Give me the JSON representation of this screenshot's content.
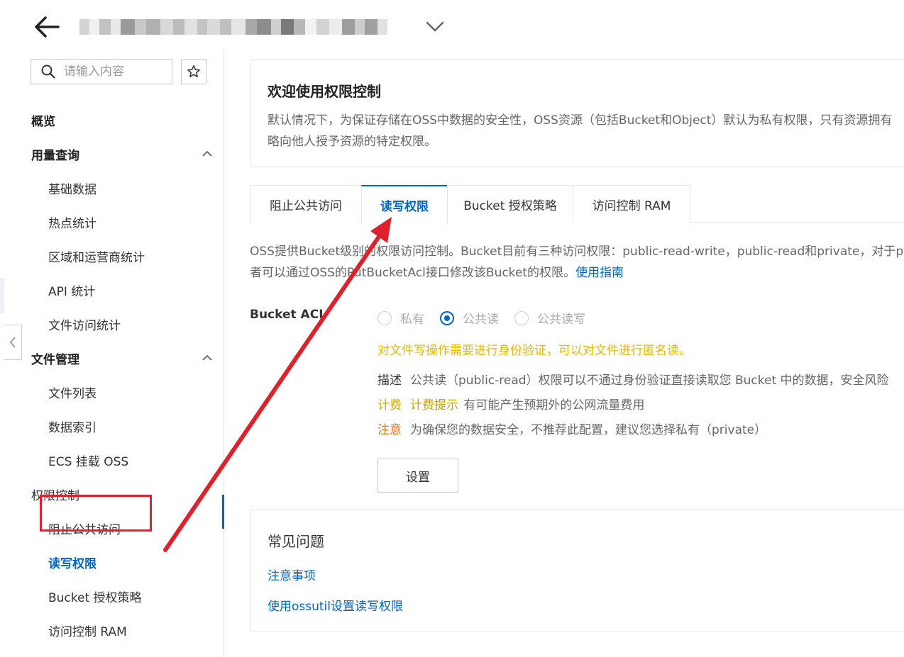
{
  "header": {
    "back_icon": "arrow-left-icon",
    "bucket_name_obscured": true,
    "dropdown_icon": "chevron-down-icon"
  },
  "sidebar": {
    "search_placeholder": "请输入内容",
    "items": [
      {
        "label": "概览",
        "level": "group"
      },
      {
        "label": "用量查询",
        "level": "group",
        "expanded": true
      },
      {
        "label": "基础数据",
        "level": "sub"
      },
      {
        "label": "热点统计",
        "level": "sub"
      },
      {
        "label": "区域和运营商统计",
        "level": "sub"
      },
      {
        "label": "API 统计",
        "level": "sub"
      },
      {
        "label": "文件访问统计",
        "level": "sub"
      },
      {
        "label": "文件管理",
        "level": "group",
        "expanded": true
      },
      {
        "label": "文件列表",
        "level": "sub"
      },
      {
        "label": "数据索引",
        "level": "sub"
      },
      {
        "label": "ECS 挂载 OSS",
        "level": "sub"
      },
      {
        "label": "权限控制",
        "level": "group"
      },
      {
        "label": "阻止公共访问",
        "level": "sub"
      },
      {
        "label": "读写权限",
        "level": "sub",
        "active": true
      },
      {
        "label": "Bucket 授权策略",
        "level": "sub"
      },
      {
        "label": "访问控制 RAM",
        "level": "sub"
      }
    ]
  },
  "welcome": {
    "title": "欢迎使用权限控制",
    "line1": "默认情况下，为保证存储在OSS中数据的安全性，OSS资源（包括Bucket和Object）默认为私有权限，只有资源拥有",
    "line2": "略向他人授予资源的特定权限。"
  },
  "tabs": [
    {
      "label": "阻止公共访问"
    },
    {
      "label": "读写权限",
      "active": true
    },
    {
      "label": "Bucket 授权策略"
    },
    {
      "label": "访问控制 RAM"
    }
  ],
  "description": {
    "line1": "OSS提供Bucket级别的权限访问控制。Bucket目前有三种访问权限：public-read-write，public-read和private，对于pr",
    "line2_prefix": "者可以通过OSS的PutBucketAcl接口修改该Bucket的权限。",
    "link": "使用指南"
  },
  "acl": {
    "label": "Bucket ACL",
    "options": [
      {
        "label": "私有",
        "checked": false
      },
      {
        "label": "公共读",
        "checked": true
      },
      {
        "label": "公共读写",
        "checked": false
      }
    ],
    "warning": "对文件写操作需要进行身份验证，可以对文件进行匿名读。",
    "desc_key": "描述",
    "desc_text": "公共读（public-read）权限可以不通过身份验证直接读取您 Bucket 中的数据，安全风险",
    "fee_key": "计费",
    "fee_hint": "计费提示",
    "fee_text": "有可能产生预期外的公网流量费用",
    "note_key": "注意",
    "note_text": "为确保您的数据安全，不推荐此配置，建议您选择私有（private）",
    "set_button": "设置"
  },
  "faq": {
    "title": "常见问题",
    "links": [
      "注意事项",
      "使用ossutil设置读写权限"
    ]
  },
  "colors": {
    "primary": "#0064c8",
    "warning": "#e6b800",
    "annotation": "#e0202a"
  }
}
